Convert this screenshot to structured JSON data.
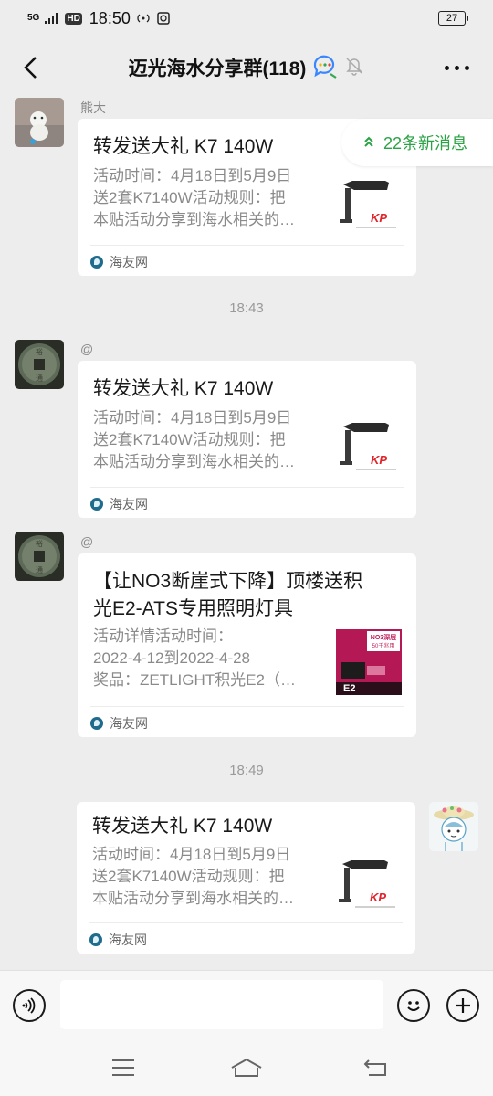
{
  "status_bar": {
    "signal": "5G",
    "hd": "HD",
    "time": "18:50",
    "battery": "27",
    "icons": [
      "signal-icon",
      "hd-icon",
      "hotspot-icon",
      "notification-icon",
      "battery-icon"
    ]
  },
  "header": {
    "title": "迈光海水分享群(118)",
    "icons": [
      "back-icon",
      "group-chat-icon",
      "mute-bell-icon",
      "more-icon"
    ]
  },
  "unread": {
    "label": "22条新消息"
  },
  "messages": [
    {
      "sender": "熊大",
      "card": {
        "title": "转发送大礼 K7 140W",
        "desc": [
          "活动时间：4月18日到5月9日",
          "送2套K7140W活动规则：把",
          "本贴活动分享到海水相关的…"
        ],
        "source": "海友网",
        "thumb": "k7-light"
      }
    },
    {
      "timestamp": "18:43"
    },
    {
      "sender": "@",
      "card": {
        "title": "转发送大礼 K7 140W",
        "desc": [
          "活动时间：4月18日到5月9日",
          "送2套K7140W活动规则：把",
          "本贴活动分享到海水相关的…"
        ],
        "source": "海友网",
        "thumb": "k7-light"
      }
    },
    {
      "sender": "@",
      "card": {
        "title_lines": [
          "【让NO3断崖式下降】顶楼送积",
          "光E2-ATS专用照明灯具"
        ],
        "desc": [
          "活动详情活动时间：",
          "2022-4-12到2022-4-28",
          "奖品：ZETLIGHT积光E2（…"
        ],
        "source": "海友网",
        "thumb": "e2-light",
        "thumb_text": [
          "NO3深层",
          "50千兆用",
          "E2"
        ]
      }
    },
    {
      "timestamp": "18:49"
    },
    {
      "sender": "me",
      "card": {
        "title": "转发送大礼 K7 140W",
        "desc": [
          "活动时间：4月18日到5月9日",
          "送2套K7140W活动规则：把",
          "本贴活动分享到海水相关的…"
        ],
        "source": "海友网",
        "thumb": "k7-light"
      }
    }
  ],
  "thumb_k7_brand": "KP",
  "input_bar": {
    "placeholder": "",
    "icons": [
      "voice-icon",
      "emoji-icon",
      "plus-icon"
    ]
  },
  "nav_bar": {
    "icons": [
      "menu-icon",
      "home-icon",
      "back-nav-icon"
    ]
  },
  "colors": {
    "background": "#ededed",
    "accent_green": "#2ba245",
    "card_bg": "#ffffff",
    "thumb_brand_red": "#e0242a"
  }
}
